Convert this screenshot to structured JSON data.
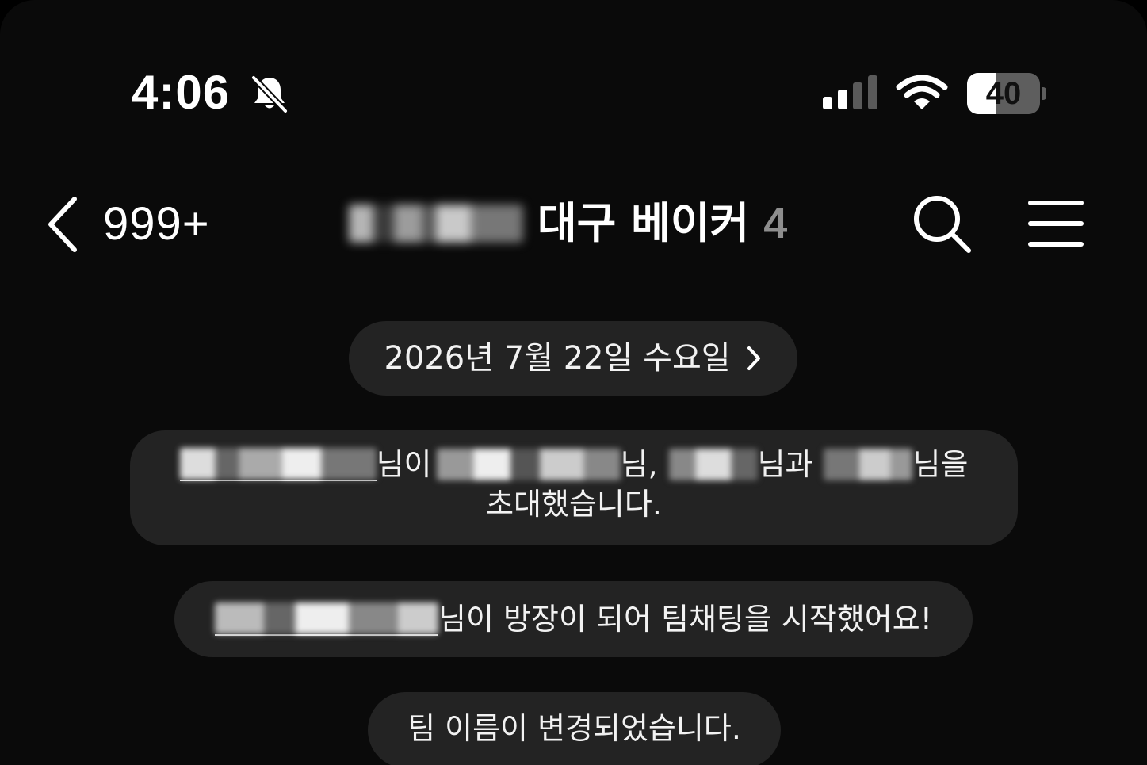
{
  "status_bar": {
    "time": "4:06",
    "silent_icon": "bell-slash-icon",
    "signal_icon": "cellular-signal-icon",
    "signal_bars_filled": 2,
    "signal_bars_total": 4,
    "wifi_icon": "wifi-icon",
    "battery_level": "40",
    "battery_fraction": 0.4
  },
  "header": {
    "back_icon": "chevron-left-icon",
    "unread_count": "999+",
    "title": "대구 베이커",
    "member_count": "4",
    "search_icon": "search-icon",
    "menu_icon": "hamburger-menu-icon"
  },
  "messages": {
    "date_divider": "2026년 7월 22일 수요일",
    "date_chevron_icon": "chevron-right-icon",
    "invite": {
      "part1": "님이",
      "part2": "님,",
      "part3": "님과",
      "part4": "님을",
      "line2": "초대했습니다."
    },
    "owner_started": "님이 방장이 되어 팀채팅을 시작했어요!",
    "renamed": "팀 이름이 변경되었습니다."
  },
  "colors": {
    "background": "#0a0a0a",
    "pill_background": "#232323",
    "text": "#ffffff",
    "muted": "#8e8e8e"
  }
}
